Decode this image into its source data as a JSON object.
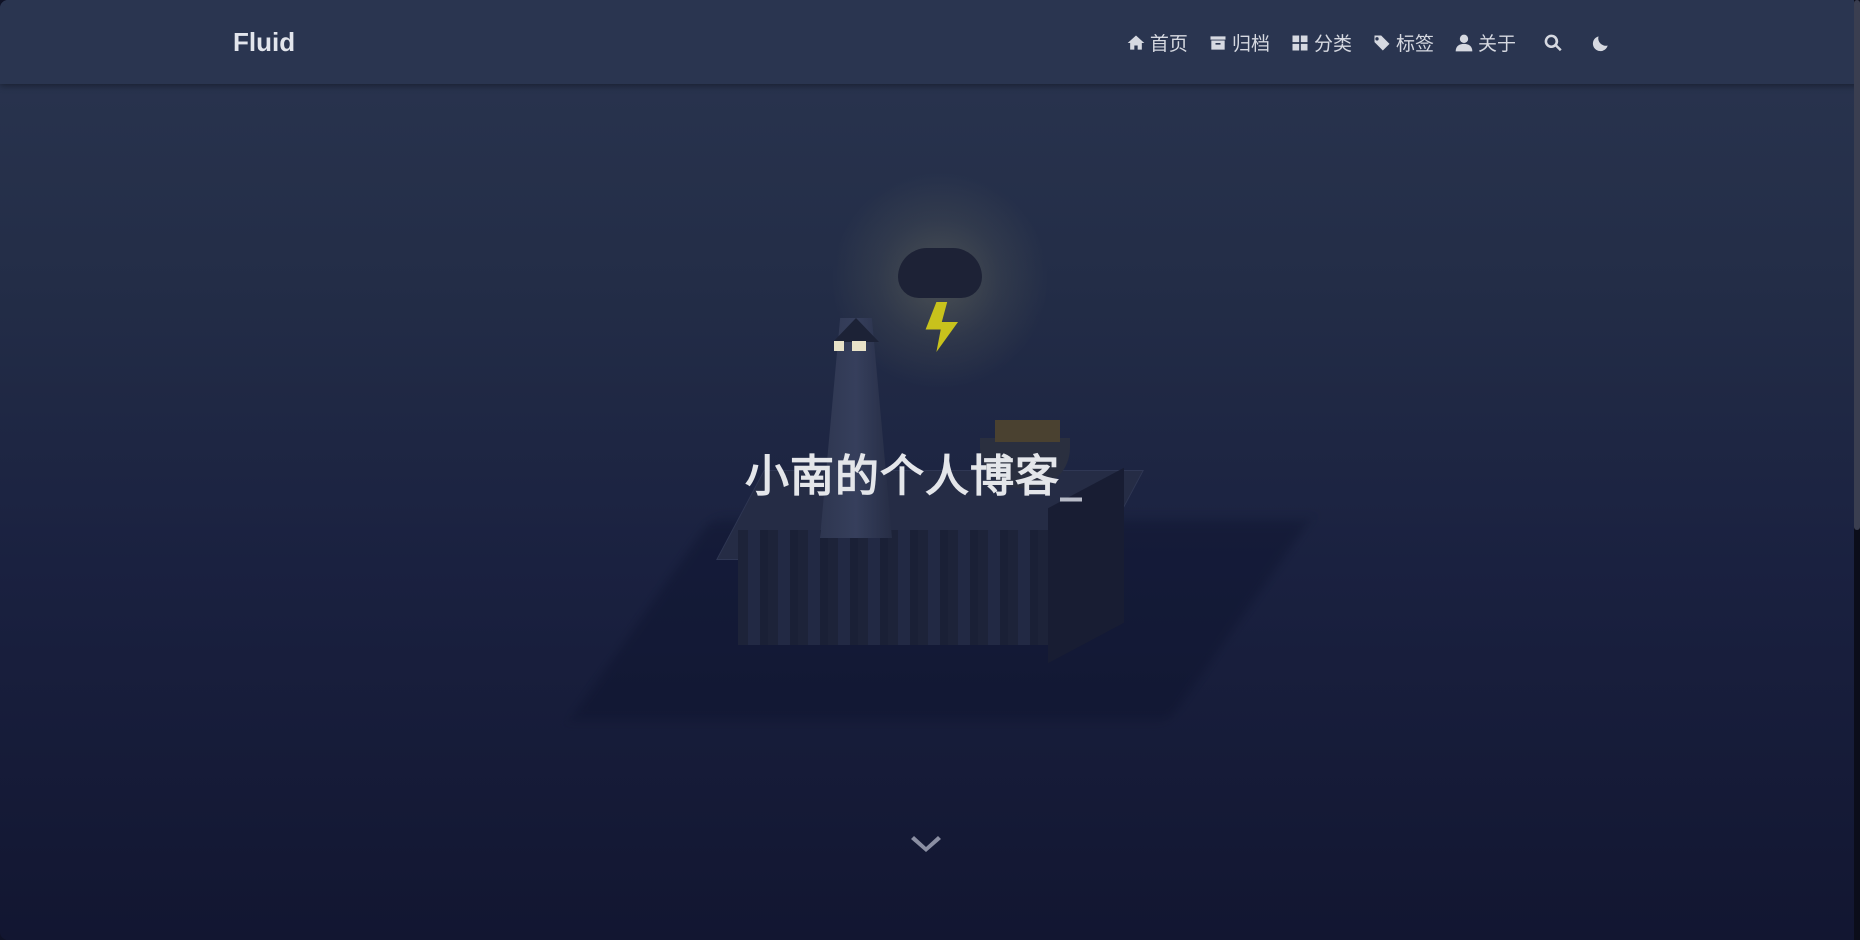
{
  "brand": {
    "name": "Fluid"
  },
  "nav": {
    "items": [
      {
        "label": "首页",
        "icon": "home-icon"
      },
      {
        "label": "归档",
        "icon": "archive-icon"
      },
      {
        "label": "分类",
        "icon": "category-icon"
      },
      {
        "label": "标签",
        "icon": "tags-icon"
      },
      {
        "label": "关于",
        "icon": "user-icon"
      }
    ],
    "search_icon": "search-icon",
    "theme_icon": "moon-icon"
  },
  "hero": {
    "title": "小南的个人博客",
    "cursor": "_",
    "scroll_icon": "chevron-down-icon"
  },
  "colors": {
    "navbar": "#2a3550",
    "background_top": "#2a3550",
    "background_bottom": "#121631",
    "text": "#dcdfe6",
    "bolt": "#c8c21c"
  }
}
